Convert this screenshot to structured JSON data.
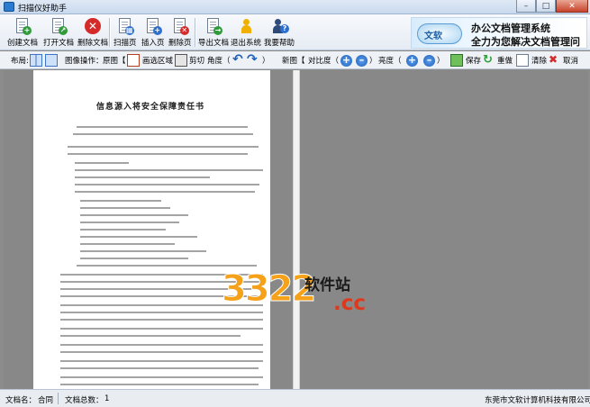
{
  "window": {
    "title": "扫描仪好助手",
    "buttons": [
      "minimize",
      "maximize",
      "close"
    ]
  },
  "toolbar": {
    "create_doc": "创建文档",
    "open_doc": "打开文档",
    "delete_doc": "删除文档",
    "scan_page": "扫描页",
    "insert_page": "插入页",
    "delete_page": "删除页",
    "export_doc": "导出文档",
    "exit_system": "退出系统",
    "want_help": "我要帮助"
  },
  "banner": {
    "logo": "文软",
    "line1": "办公文档管理系统",
    "line2": "全力为您解决文档管理问题"
  },
  "toolbar2": {
    "layout_label": "布局:",
    "image_ops_label": "图像操作：",
    "original_label": "原图【",
    "draw_area": "画选区域",
    "crop": "剪切",
    "angle_label": "角度（",
    "angle_close": "）",
    "new_image_label": "新图【",
    "contrast_label": "对比度（",
    "contrast_close": "）",
    "brightness_label": "亮度（",
    "brightness_close": "）",
    "save": "保存",
    "redo": "重做",
    "clear": "清除",
    "cancel": "取消"
  },
  "document_preview": {
    "heading": "信息源入将安全保障责任书"
  },
  "watermark": {
    "number": "3322",
    "site_cn": "软件站",
    "domain": ".cc"
  },
  "status": {
    "doc_name_label": "文档名：",
    "doc_name": "合同",
    "doc_count_label": "文档总数：",
    "doc_count": "1",
    "company": "东莞市文软计算机科技有限公司"
  }
}
